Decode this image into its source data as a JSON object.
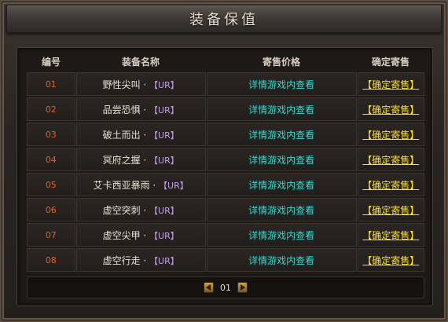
{
  "window": {
    "title": "装备保值"
  },
  "table": {
    "headers": {
      "no": "编号",
      "name": "装备名称",
      "price": "寄售价格",
      "action": "确定寄售"
    },
    "rows": [
      {
        "no": "01",
        "name": "野性尖叫 · ",
        "tag": "【UR】",
        "price": "详情游戏内查看",
        "action": "【确定寄售】"
      },
      {
        "no": "02",
        "name": "品尝恐惧 · ",
        "tag": "【UR】",
        "price": "详情游戏内查看",
        "action": "【确定寄售】"
      },
      {
        "no": "03",
        "name": "破土而出 · ",
        "tag": "【UR】",
        "price": "详情游戏内查看",
        "action": "【确定寄售】"
      },
      {
        "no": "04",
        "name": "冥府之握 · ",
        "tag": "【UR】",
        "price": "详情游戏内查看",
        "action": "【确定寄售】"
      },
      {
        "no": "05",
        "name": "艾卡西亚暴雨 · ",
        "tag": "【UR】",
        "price": "详情游戏内查看",
        "action": "【确定寄售】"
      },
      {
        "no": "06",
        "name": "虚空突刺 · ",
        "tag": "【UR】",
        "price": "详情游戏内查看",
        "action": "【确定寄售】"
      },
      {
        "no": "07",
        "name": "虚空尖甲 · ",
        "tag": "【UR】",
        "price": "详情游戏内查看",
        "action": "【确定寄售】"
      },
      {
        "no": "08",
        "name": "虚空行走 · ",
        "tag": "【UR】",
        "price": "详情游戏内查看",
        "action": "【确定寄售】"
      }
    ]
  },
  "pager": {
    "page": "01",
    "prev_icon": "triangle-left-icon",
    "next_icon": "triangle-right-icon"
  },
  "colors": {
    "number": "#e0602c",
    "tag": "#c79cf0",
    "price": "#3ad7d0",
    "action": "#ffe030"
  }
}
